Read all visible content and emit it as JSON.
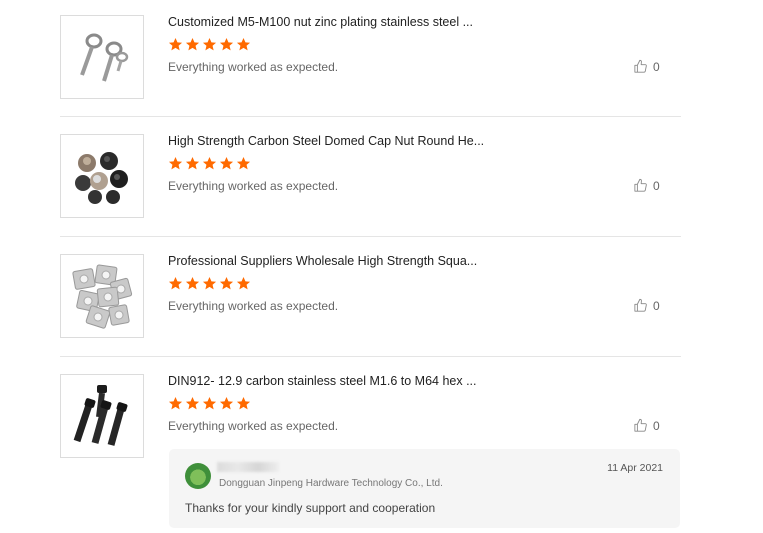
{
  "reviews": [
    {
      "title": "Customized M5-M100 nut zinc plating stainless steel ...",
      "rating": 5,
      "text": "Everything worked as expected.",
      "likes": "0",
      "image": "eye-bolt-image"
    },
    {
      "title": "High Strength Carbon Steel Domed Cap Nut Round He...",
      "rating": 5,
      "text": "Everything worked as expected.",
      "likes": "0",
      "image": "cap-nut-image"
    },
    {
      "title": "Professional Suppliers Wholesale High Strength Squa...",
      "rating": 5,
      "text": "Everything worked as expected.",
      "likes": "0",
      "image": "square-nut-image"
    },
    {
      "title": "DIN912- 12.9 carbon stainless steel M1.6 to M64 hex ...",
      "rating": 5,
      "text": "Everything worked as expected.",
      "likes": "0",
      "image": "hex-socket-bolt-image"
    }
  ],
  "reply": {
    "company": "Dongguan Jinpeng Hardware Technology Co., Ltd.",
    "date": "11 Apr 2021",
    "text": "Thanks for your kindly support and cooperation"
  },
  "colors": {
    "star": "#ff6a00",
    "divider": "#e5e5e5",
    "reply_bg": "#f5f5f5"
  }
}
